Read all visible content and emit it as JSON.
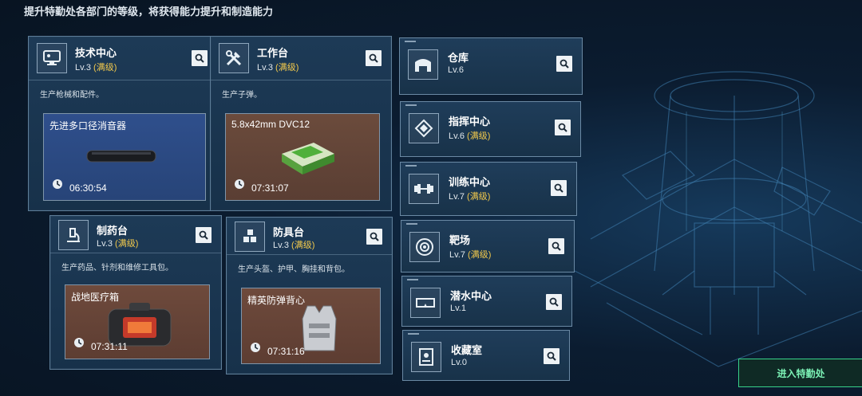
{
  "header": {
    "text": "提升特勤处各部门的等级，将获得能力提升和制造能力"
  },
  "production_departments": [
    {
      "name": "技术中心",
      "level_prefix": "Lv.3",
      "level_suffix": "(满级)",
      "desc": "生产枪械和配件。",
      "product": "先进多口径消音器",
      "timer": "06:30:54",
      "icon": "monitor-icon"
    },
    {
      "name": "工作台",
      "level_prefix": "Lv.3",
      "level_suffix": "(满级)",
      "desc": "生产子弹。",
      "product": "5.8x42mm DVC12",
      "timer": "07:31:07",
      "icon": "wrench-hammer-icon"
    },
    {
      "name": "制药台",
      "level_prefix": "Lv.3",
      "level_suffix": "(满级)",
      "desc": "生产药品、针剂和维修工具包。",
      "product": "战地医疗箱",
      "timer": "07:31:11",
      "icon": "microscope-icon"
    },
    {
      "name": "防具台",
      "level_prefix": "Lv.3",
      "level_suffix": "(满级)",
      "desc": "生产头盔、护甲、胸挂和背包。",
      "product": "精英防弹背心",
      "timer": "07:31:16",
      "icon": "cubes-icon"
    }
  ],
  "other_departments": [
    {
      "name": "仓库",
      "level_prefix": "Lv.6",
      "level_suffix": "",
      "icon": "warehouse-icon"
    },
    {
      "name": "指挥中心",
      "level_prefix": "Lv.6",
      "level_suffix": "(满级)",
      "icon": "command-icon"
    },
    {
      "name": "训练中心",
      "level_prefix": "Lv.7",
      "level_suffix": "(满级)",
      "icon": "dumbbell-icon"
    },
    {
      "name": "靶场",
      "level_prefix": "Lv.7",
      "level_suffix": "(满级)",
      "icon": "target-icon"
    },
    {
      "name": "潜水中心",
      "level_prefix": "Lv.1",
      "level_suffix": "",
      "icon": "diving-mask-icon"
    },
    {
      "name": "收藏室",
      "level_prefix": "Lv.0",
      "level_suffix": "",
      "icon": "collection-icon"
    }
  ],
  "enter_button": {
    "label": "进入特勤处"
  },
  "colors": {
    "maxed": "#f2c94c",
    "accent_green": "#38d28a",
    "panel": "#1d3a56"
  }
}
